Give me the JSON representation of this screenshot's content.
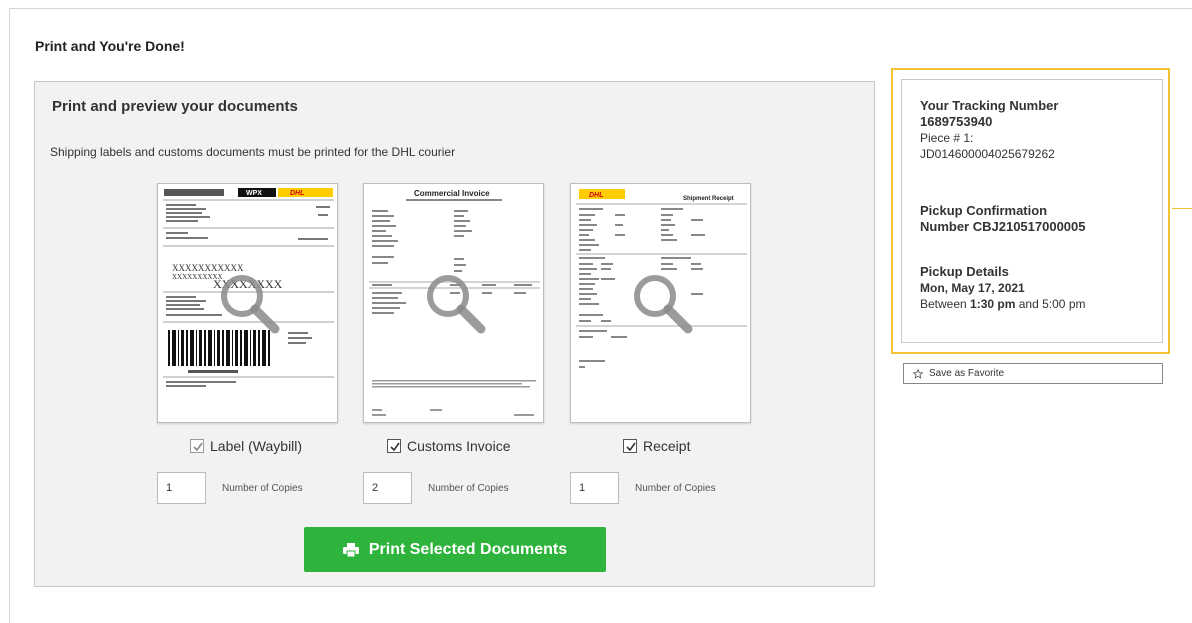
{
  "page": {
    "title": "Print and You're Done!"
  },
  "documents_panel": {
    "title": "Print and preview your documents",
    "subtitle": "Shipping labels and customs documents must be printed for the DHL courier",
    "documents": [
      {
        "label": "Label (Waybill)",
        "checked": true,
        "disabled": true,
        "copies": "1"
      },
      {
        "label": "Customs Invoice",
        "checked": true,
        "disabled": false,
        "copies": "2"
      },
      {
        "label": "Receipt",
        "checked": true,
        "disabled": false,
        "copies": "1"
      }
    ],
    "copies_label": "Number of Copies",
    "print_button": "Print Selected Documents"
  },
  "info": {
    "tracking_heading": "Your Tracking Number",
    "tracking_number": "1689753940",
    "piece_label": "Piece # 1:",
    "piece_number": "JD014600004025679262",
    "pickup_conf_heading": "Pickup Confirmation",
    "pickup_conf_number": "Number CBJ210517000005",
    "pickup_details_heading": "Pickup Details",
    "pickup_date": "Mon, May 17, 2021",
    "between": "Between",
    "start_time": "1:30 pm",
    "and": "and",
    "end_time": "5:00 pm"
  },
  "favorite_button": "Save as Favorite",
  "colors": {
    "print_button": "#2eb43c",
    "highlight": "#f1c232",
    "panel_bg": "#f2f2f2"
  },
  "icons": {
    "preview": "magnifier-icon",
    "print": "printer-icon",
    "favorite": "star-icon",
    "checkbox": "checkmark-icon"
  }
}
